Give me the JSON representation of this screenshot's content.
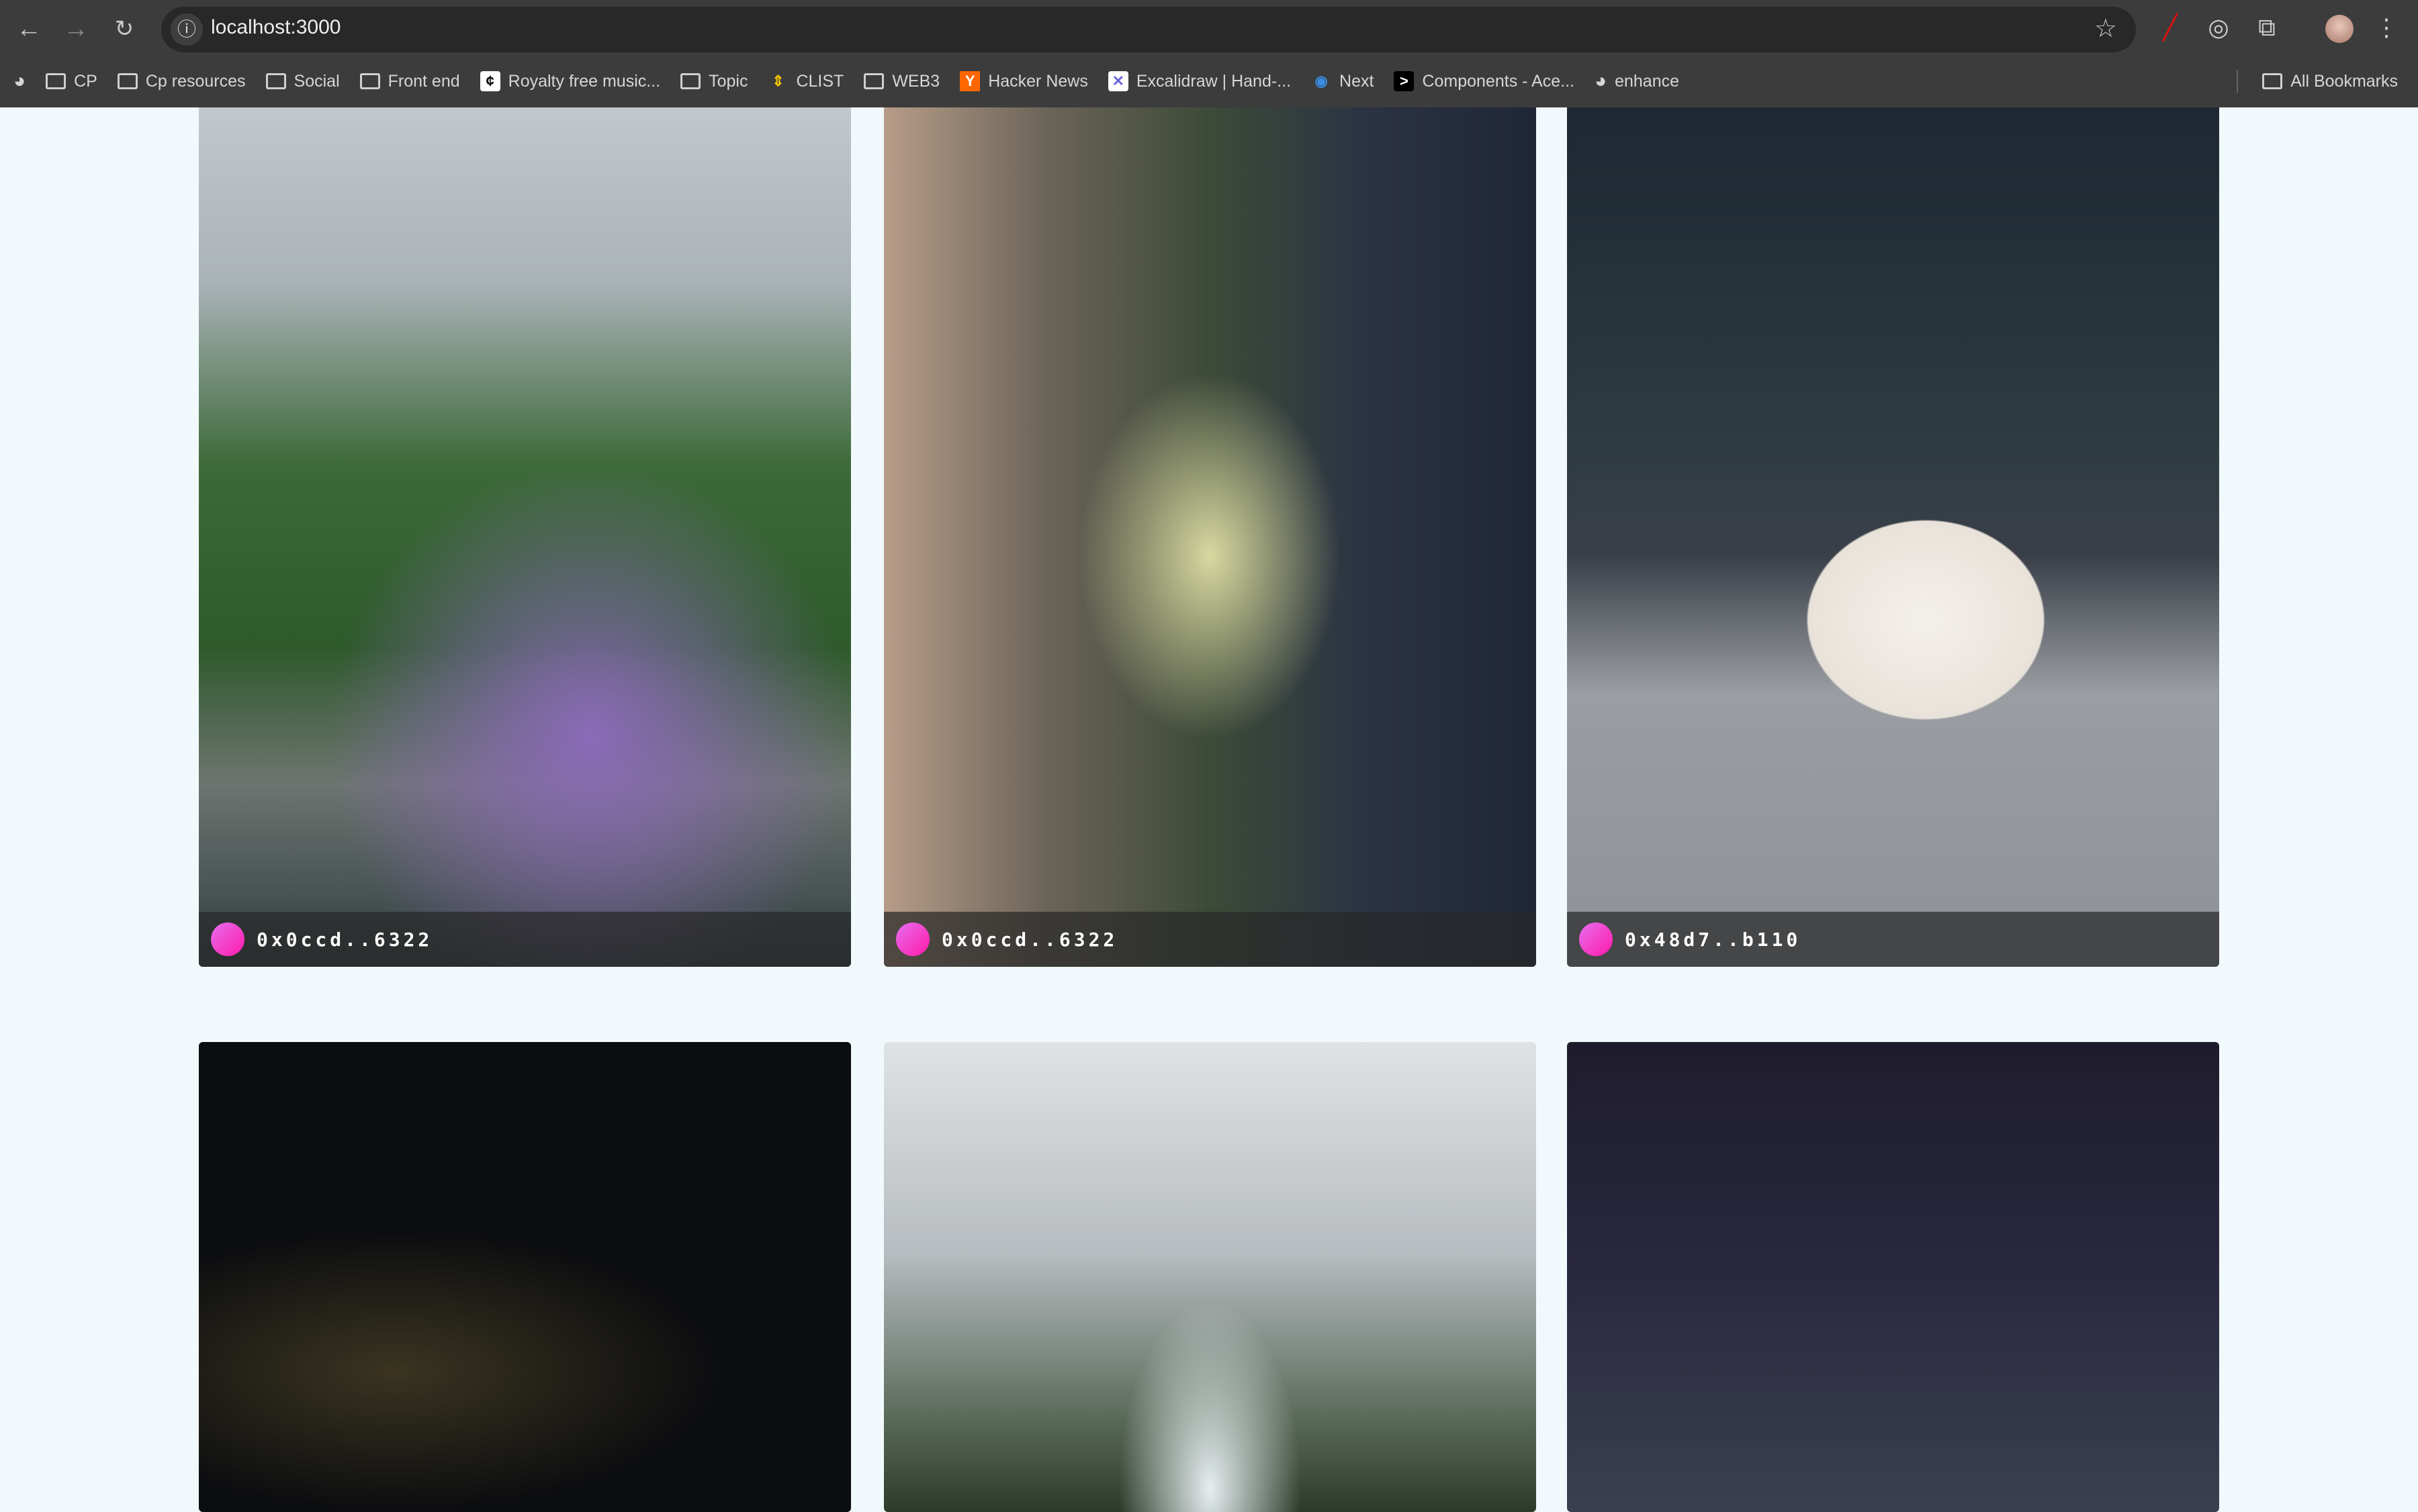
{
  "browser": {
    "url": "localhost:3000",
    "bookmarks": [
      {
        "label": "",
        "icon": "globe-icon"
      },
      {
        "label": "CP",
        "icon": "folder-icon"
      },
      {
        "label": "Cp resources",
        "icon": "folder-icon"
      },
      {
        "label": "Social",
        "icon": "folder-icon"
      },
      {
        "label": "Front end",
        "icon": "folder-icon"
      },
      {
        "label": "Royalty free music...",
        "icon": "music-site-icon"
      },
      {
        "label": "Topic",
        "icon": "folder-icon"
      },
      {
        "label": "CLIST",
        "icon": "clist-icon"
      },
      {
        "label": "WEB3",
        "icon": "folder-icon"
      },
      {
        "label": "Hacker News",
        "icon": "hacker-news-icon"
      },
      {
        "label": "Excalidraw | Hand-...",
        "icon": "excalidraw-icon"
      },
      {
        "label": "Next",
        "icon": "next-icon"
      },
      {
        "label": "Components - Ace...",
        "icon": "terminal-icon"
      },
      {
        "label": "enhance",
        "icon": "globe-icon"
      }
    ],
    "all_bookmarks": "All Bookmarks"
  },
  "gallery": {
    "cards": [
      {
        "owner": "0x0ccd..6322",
        "avatar_color": "#f03cc8"
      },
      {
        "owner": "0x0ccd..6322",
        "avatar_color": "#f03cc8"
      },
      {
        "owner": "0x48d7..b110",
        "avatar_color": "#f03cc8"
      },
      {
        "owner": ""
      },
      {
        "owner": ""
      },
      {
        "owner": ""
      }
    ]
  }
}
